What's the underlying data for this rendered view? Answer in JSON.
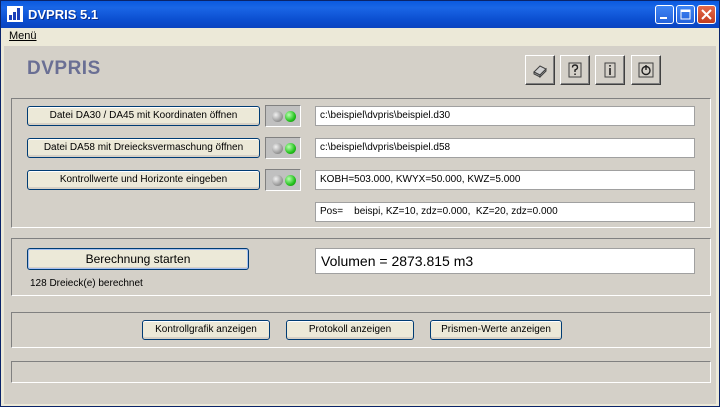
{
  "window": {
    "title": "DVPRIS 5.1"
  },
  "menu": {
    "items": [
      {
        "label": "Menü"
      }
    ]
  },
  "header": {
    "logo": "DVPRIS",
    "toolbar_icons": [
      "eraser-icon",
      "help-icon",
      "info-icon",
      "power-icon"
    ]
  },
  "files": {
    "rows": [
      {
        "button": "Datei  DA30 / DA45   mit Koordinaten öffnen",
        "value": "c:\\beispiel\\dvpris\\beispiel.d30",
        "status": [
          "grey",
          "green"
        ]
      },
      {
        "button": "Datei DA58  mit Dreiecksvermaschung öffnen",
        "value": "c:\\beispiel\\dvpris\\beispiel.d58",
        "status": [
          "grey",
          "green"
        ]
      },
      {
        "button": "Kontrollwerte und Horizonte eingeben",
        "value": "KOBH=503.000, KWYX=50.000, KWZ=5.000",
        "status": [
          "grey",
          "green"
        ]
      }
    ],
    "horizon_value": "Pos=    beispi, KZ=10, zdz=0.000,  KZ=20, zdz=0.000"
  },
  "calc": {
    "button": "Berechnung starten",
    "status": "128 Dreieck(e) berechnet",
    "result": "Volumen = 2873.815 m3"
  },
  "views": {
    "buttons": [
      "Kontrollgrafik anzeigen",
      "Protokoll anzeigen",
      "Prismen-Werte anzeigen"
    ]
  },
  "colors": {
    "title_bar": "#0a5ae0",
    "logo": "#6a6f94",
    "led_green": "#23c21c",
    "face": "#d4d0c8"
  }
}
